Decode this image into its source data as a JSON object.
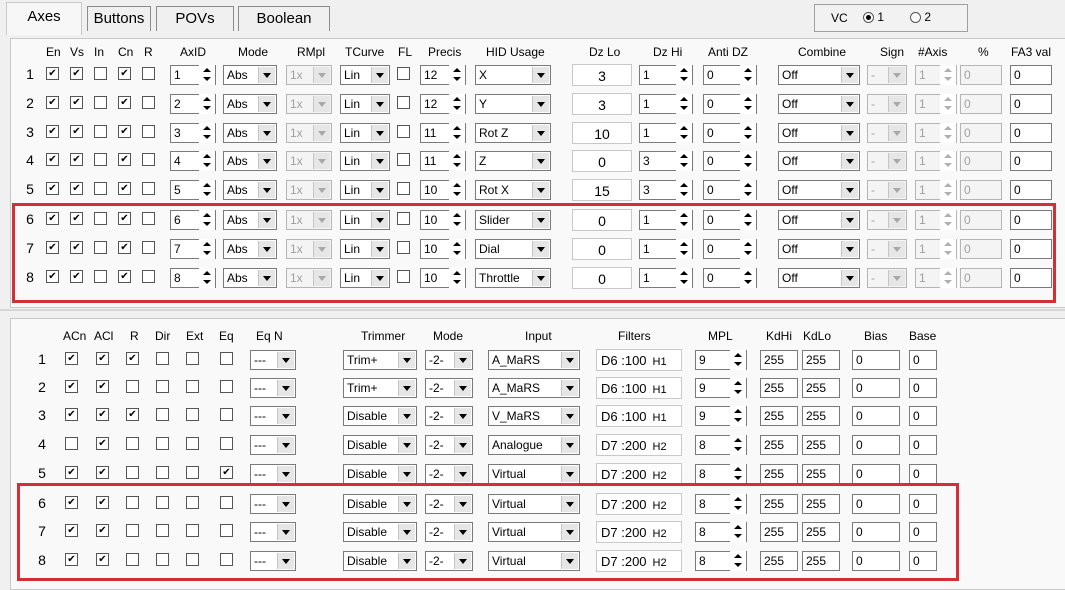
{
  "tabs": [
    {
      "label": "Axes",
      "active": true
    },
    {
      "label": "Buttons",
      "active": false
    },
    {
      "label": "POVs",
      "active": false
    },
    {
      "label": "Boolean",
      "active": false
    }
  ],
  "vc": {
    "label": "VC",
    "options": [
      {
        "label": "1",
        "selected": true
      },
      {
        "label": "2",
        "selected": false
      }
    ]
  },
  "top": {
    "headers": {
      "en": "En",
      "vs": "Vs",
      "in": "In",
      "cn": "Cn",
      "r": "R",
      "axid": "AxID",
      "mode": "Mode",
      "rmpl": "RMpl",
      "tcurve": "TCurve",
      "fl": "FL",
      "precis": "Precis",
      "hid": "HID Usage",
      "dzlo": "Dz Lo",
      "dzhi": "Dz Hi",
      "antidz": "Anti DZ",
      "combine": "Combine",
      "sign": "Sign",
      "naxis": "#Axis",
      "pct": "%",
      "fa3": "FA3 val"
    },
    "rows": [
      {
        "n": "1",
        "en": true,
        "vs": true,
        "in": false,
        "cn": true,
        "r": false,
        "axid": "1",
        "mode": "Abs",
        "rmpl": "1x",
        "tcurve": "Lin",
        "fl": false,
        "precis": "12",
        "hid": "X",
        "dzlo": "3",
        "dzhi": "1",
        "antidz": "0",
        "combine": "Off",
        "sign": "-",
        "naxis": "1",
        "pct": "0",
        "fa3": "0"
      },
      {
        "n": "2",
        "en": true,
        "vs": true,
        "in": false,
        "cn": true,
        "r": false,
        "axid": "2",
        "mode": "Abs",
        "rmpl": "1x",
        "tcurve": "Lin",
        "fl": false,
        "precis": "12",
        "hid": "Y",
        "dzlo": "3",
        "dzhi": "1",
        "antidz": "0",
        "combine": "Off",
        "sign": "-",
        "naxis": "1",
        "pct": "0",
        "fa3": "0"
      },
      {
        "n": "3",
        "en": true,
        "vs": true,
        "in": false,
        "cn": true,
        "r": false,
        "axid": "3",
        "mode": "Abs",
        "rmpl": "1x",
        "tcurve": "Lin",
        "fl": false,
        "precis": "11",
        "hid": "Rot Z",
        "dzlo": "10",
        "dzhi": "1",
        "antidz": "0",
        "combine": "Off",
        "sign": "-",
        "naxis": "1",
        "pct": "0",
        "fa3": "0"
      },
      {
        "n": "4",
        "en": true,
        "vs": true,
        "in": false,
        "cn": true,
        "r": false,
        "axid": "4",
        "mode": "Abs",
        "rmpl": "1x",
        "tcurve": "Lin",
        "fl": false,
        "precis": "11",
        "hid": "Z",
        "dzlo": "0",
        "dzhi": "3",
        "antidz": "0",
        "combine": "Off",
        "sign": "-",
        "naxis": "1",
        "pct": "0",
        "fa3": "0"
      },
      {
        "n": "5",
        "en": true,
        "vs": true,
        "in": false,
        "cn": true,
        "r": false,
        "axid": "5",
        "mode": "Abs",
        "rmpl": "1x",
        "tcurve": "Lin",
        "fl": false,
        "precis": "10",
        "hid": "Rot X",
        "dzlo": "15",
        "dzhi": "3",
        "antidz": "0",
        "combine": "Off",
        "sign": "-",
        "naxis": "1",
        "pct": "0",
        "fa3": "0"
      },
      {
        "n": "6",
        "en": true,
        "vs": true,
        "in": false,
        "cn": true,
        "r": false,
        "axid": "6",
        "mode": "Abs",
        "rmpl": "1x",
        "tcurve": "Lin",
        "fl": false,
        "precis": "10",
        "hid": "Slider",
        "dzlo": "0",
        "dzhi": "1",
        "antidz": "0",
        "combine": "Off",
        "sign": "-",
        "naxis": "1",
        "pct": "0",
        "fa3": "0"
      },
      {
        "n": "7",
        "en": true,
        "vs": true,
        "in": false,
        "cn": true,
        "r": false,
        "axid": "7",
        "mode": "Abs",
        "rmpl": "1x",
        "tcurve": "Lin",
        "fl": false,
        "precis": "10",
        "hid": "Dial",
        "dzlo": "0",
        "dzhi": "1",
        "antidz": "0",
        "combine": "Off",
        "sign": "-",
        "naxis": "1",
        "pct": "0",
        "fa3": "0"
      },
      {
        "n": "8",
        "en": true,
        "vs": true,
        "in": false,
        "cn": true,
        "r": false,
        "axid": "8",
        "mode": "Abs",
        "rmpl": "1x",
        "tcurve": "Lin",
        "fl": false,
        "precis": "10",
        "hid": "Throttle",
        "dzlo": "0",
        "dzhi": "1",
        "antidz": "0",
        "combine": "Off",
        "sign": "-",
        "naxis": "1",
        "pct": "0",
        "fa3": "0"
      }
    ]
  },
  "bottom": {
    "headers": {
      "acn": "ACn",
      "acl": "ACl",
      "r": "R",
      "dir": "Dir",
      "ext": "Ext",
      "eq": "Eq",
      "eqn": "Eq N",
      "trimmer": "Trimmer",
      "mode": "Mode",
      "input": "Input",
      "filters": "Filters",
      "mpl": "MPL",
      "kdhi": "KdHi",
      "kdlo": "KdLo",
      "bias": "Bias",
      "base": "Base"
    },
    "rows": [
      {
        "n": "1",
        "acn": true,
        "acl": true,
        "r": true,
        "dir": false,
        "ext": false,
        "eq": false,
        "eqn": "---",
        "trimmer": "Trim+",
        "mode": "-2-",
        "input": "A_MaRS",
        "filt": "D6 :100",
        "filth": "H1",
        "mpl": "9",
        "kdhi": "255",
        "kdlo": "255",
        "bias": "0",
        "base": "0"
      },
      {
        "n": "2",
        "acn": true,
        "acl": true,
        "r": false,
        "dir": false,
        "ext": false,
        "eq": false,
        "eqn": "---",
        "trimmer": "Trim+",
        "mode": "-2-",
        "input": "A_MaRS",
        "filt": "D6 :100",
        "filth": "H1",
        "mpl": "9",
        "kdhi": "255",
        "kdlo": "255",
        "bias": "0",
        "base": "0"
      },
      {
        "n": "3",
        "acn": true,
        "acl": true,
        "r": true,
        "dir": false,
        "ext": false,
        "eq": false,
        "eqn": "---",
        "trimmer": "Disable",
        "mode": "-2-",
        "input": "V_MaRS",
        "filt": "D6 :100",
        "filth": "H1",
        "mpl": "9",
        "kdhi": "255",
        "kdlo": "255",
        "bias": "0",
        "base": "0"
      },
      {
        "n": "4",
        "acn": false,
        "acl": true,
        "r": false,
        "dir": false,
        "ext": false,
        "eq": false,
        "eqn": "---",
        "trimmer": "Disable",
        "mode": "-2-",
        "input": "Analogue",
        "filt": "D7 :200",
        "filth": "H2",
        "mpl": "8",
        "kdhi": "255",
        "kdlo": "255",
        "bias": "0",
        "base": "0"
      },
      {
        "n": "5",
        "acn": true,
        "acl": true,
        "r": false,
        "dir": false,
        "ext": false,
        "eq": true,
        "eqn": "---",
        "trimmer": "Disable",
        "mode": "-2-",
        "input": "Virtual",
        "filt": "D7 :200",
        "filth": "H2",
        "mpl": "8",
        "kdhi": "255",
        "kdlo": "255",
        "bias": "0",
        "base": "0"
      },
      {
        "n": "6",
        "acn": true,
        "acl": true,
        "r": false,
        "dir": false,
        "ext": false,
        "eq": false,
        "eqn": "---",
        "trimmer": "Disable",
        "mode": "-2-",
        "input": "Virtual",
        "filt": "D7 :200",
        "filth": "H2",
        "mpl": "8",
        "kdhi": "255",
        "kdlo": "255",
        "bias": "0",
        "base": "0"
      },
      {
        "n": "7",
        "acn": true,
        "acl": true,
        "r": false,
        "dir": false,
        "ext": false,
        "eq": false,
        "eqn": "---",
        "trimmer": "Disable",
        "mode": "-2-",
        "input": "Virtual",
        "filt": "D7 :200",
        "filth": "H2",
        "mpl": "8",
        "kdhi": "255",
        "kdlo": "255",
        "bias": "0",
        "base": "0"
      },
      {
        "n": "8",
        "acn": true,
        "acl": true,
        "r": false,
        "dir": false,
        "ext": false,
        "eq": false,
        "eqn": "---",
        "trimmer": "Disable",
        "mode": "-2-",
        "input": "Virtual",
        "filt": "D7 :200",
        "filth": "H2",
        "mpl": "8",
        "kdhi": "255",
        "kdlo": "255",
        "bias": "0",
        "base": "0"
      }
    ]
  },
  "highlight_color": "#d42f36"
}
